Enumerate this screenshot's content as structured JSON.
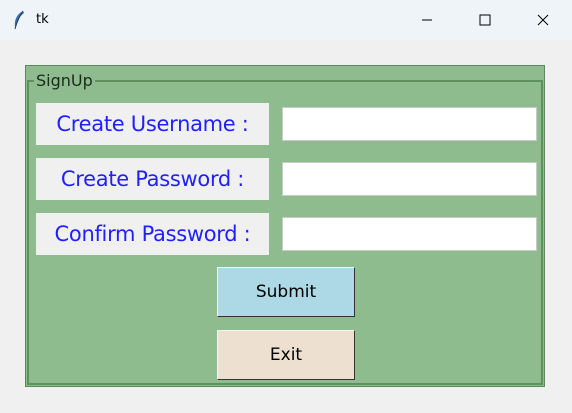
{
  "window": {
    "title": "tk"
  },
  "form": {
    "legend": "SignUp",
    "fields": [
      {
        "label": "Create Username :",
        "value": ""
      },
      {
        "label": "Create Password :",
        "value": ""
      },
      {
        "label": "Confirm Password :",
        "value": ""
      }
    ],
    "submit_label": "Submit",
    "exit_label": "Exit"
  },
  "colors": {
    "frame_bg": "#8fbc8f",
    "label_text": "#1f1fff",
    "submit_bg": "#add8e6",
    "exit_bg": "#eee0d0"
  }
}
